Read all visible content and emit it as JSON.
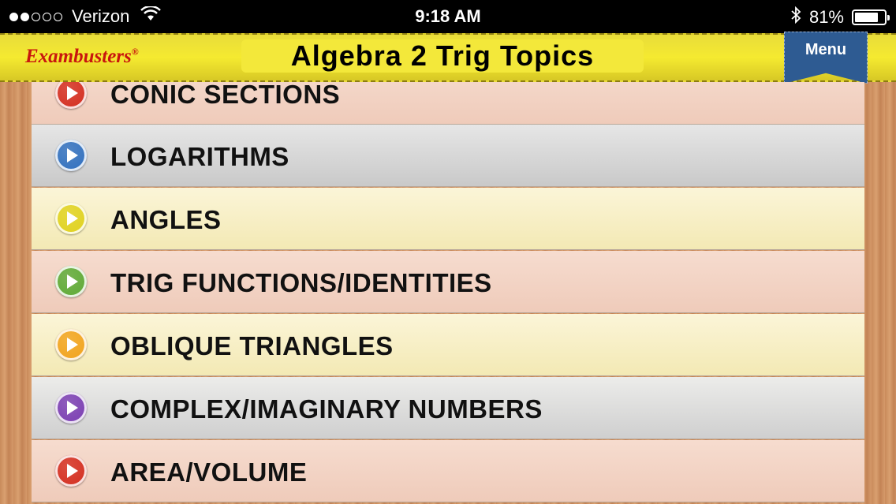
{
  "status_bar": {
    "carrier": "Verizon",
    "signal_bars_filled": 2,
    "signal_bars_total": 5,
    "time": "9:18 AM",
    "battery": "81%",
    "battery_level": 0.81
  },
  "header": {
    "brand": "Exambusters",
    "brand_mark": "®",
    "title": "Algebra 2 Trig Topics",
    "menu_label": "Menu"
  },
  "topics": [
    {
      "label": "CONIC SECTIONS",
      "color": "#d42b1e",
      "bg": "bg-peach"
    },
    {
      "label": "LOGARITHMS",
      "color": "#2e6fc0",
      "bg": "bg-gray"
    },
    {
      "label": "ANGLES",
      "color": "#e0d21c",
      "bg": "bg-cream"
    },
    {
      "label": "TRIG FUNCTIONS/IDENTITIES",
      "color": "#5aab34",
      "bg": "bg-peach"
    },
    {
      "label": "OBLIQUE TRIANGLES",
      "color": "#f2a21a",
      "bg": "bg-cream"
    },
    {
      "label": "COMPLEX/IMAGINARY NUMBERS",
      "color": "#7a3bb3",
      "bg": "bg-lgray"
    },
    {
      "label": "AREA/VOLUME",
      "color": "#d42b1e",
      "bg": "bg-peach"
    }
  ]
}
